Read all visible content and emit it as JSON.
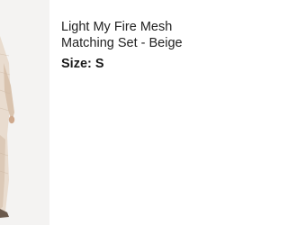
{
  "product": {
    "title": "Light My Fire Mesh Matching Set - Beige",
    "size_label": "Size:",
    "size_value": "S",
    "image_icon": "product-photo",
    "colors": {
      "image_bg": "#f4f3f2",
      "fabric": "#e7d7c6",
      "skin": "#d6b49a"
    }
  }
}
